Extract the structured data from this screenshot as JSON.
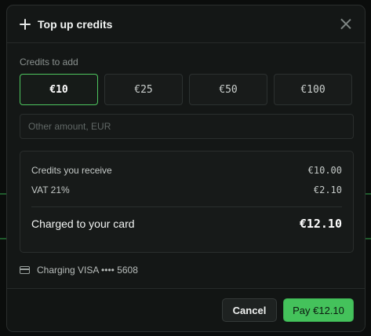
{
  "dialog": {
    "title": "Top up credits"
  },
  "credits": {
    "label": "Credits to add",
    "options": [
      "€10",
      "€25",
      "€50",
      "€100"
    ],
    "selected": "€10",
    "other_placeholder": "Other amount, EUR",
    "other_value": ""
  },
  "summary": {
    "receive_label": "Credits you receive",
    "receive_value": "€10.00",
    "vat_label": "VAT 21%",
    "vat_value": "€2.10",
    "total_label": "Charged to your card",
    "total_value": "€12.10"
  },
  "payment": {
    "charging_text": "Charging VISA •••• 5608"
  },
  "footer": {
    "cancel_label": "Cancel",
    "pay_label": "Pay €12.10"
  },
  "colors": {
    "accent": "#44c25b",
    "background": "#0b0d0c",
    "surface": "#141716"
  }
}
